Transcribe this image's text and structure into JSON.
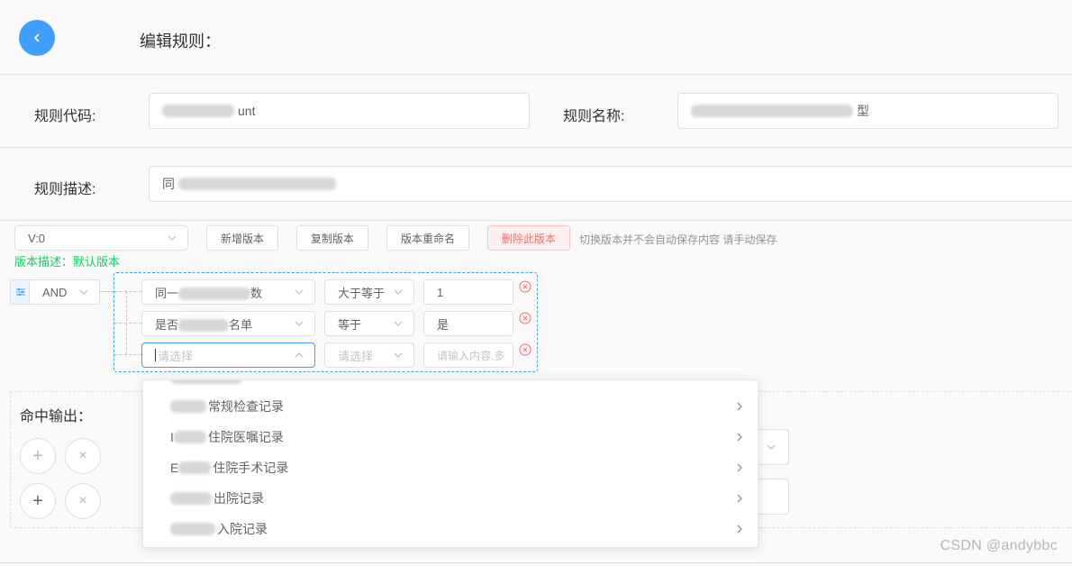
{
  "header": {
    "title": "编辑规则："
  },
  "form": {
    "rule_code_label": "规则代码:",
    "rule_code_value": "unt",
    "rule_name_label": "规则名称:",
    "rule_name_value": "型",
    "rule_desc_label": "规则描述:",
    "rule_desc_value": "同"
  },
  "version": {
    "selected": "V:0",
    "buttons": {
      "add": "新增版本",
      "copy": "复制版本",
      "rename": "版本重命名",
      "delete": "删除此版本"
    },
    "hint": "切换版本并不会自动保存内容 请手动保存",
    "desc": "版本描述：默认版本"
  },
  "conditions": {
    "logic": "AND",
    "rows": [
      {
        "field": "同一",
        "field_tail": "数",
        "operator": "大于等于",
        "value": "1"
      },
      {
        "field": "是否",
        "field_tail": "名单",
        "operator": "等于",
        "value": "是"
      },
      {
        "field_placeholder": "请选择",
        "operator_placeholder": "请选择",
        "value_placeholder": "请输入内容,多"
      }
    ]
  },
  "output": {
    "label": "命中输出："
  },
  "dropdown": {
    "items": [
      {
        "label": "常规检查记录"
      },
      {
        "prefix": "I",
        "label": "住院医嘱记录"
      },
      {
        "prefix": "E",
        "label": "住院手术记录"
      },
      {
        "label": "出院记录"
      },
      {
        "label": "入院记录"
      }
    ]
  },
  "watermark": "CSDN @andybbc",
  "colors": {
    "primary": "#409eff",
    "danger": "#f56c6c",
    "success": "#13ce66",
    "border": "#dcdfe6"
  }
}
